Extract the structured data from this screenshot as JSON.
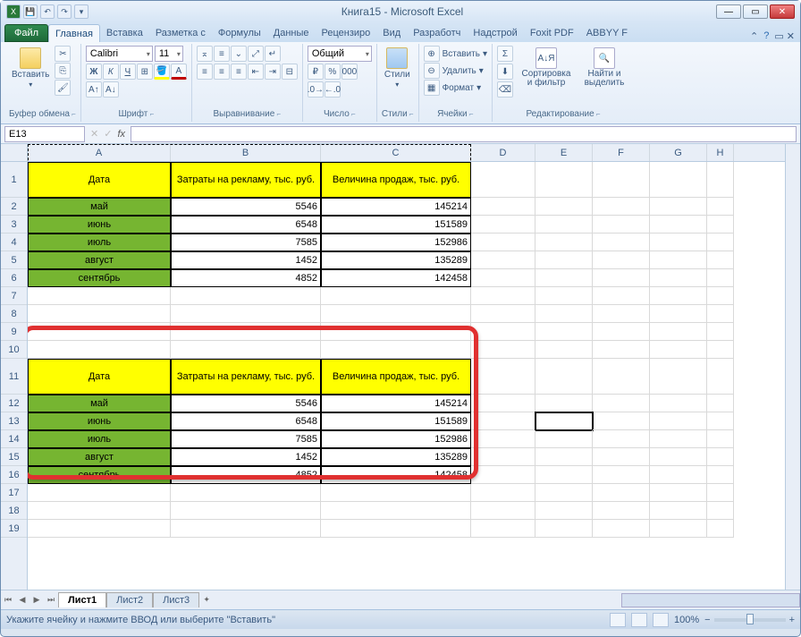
{
  "window": {
    "title": "Книга15 - Microsoft Excel"
  },
  "tabs": {
    "file": "Файл",
    "items": [
      "Главная",
      "Вставка",
      "Разметка с",
      "Формулы",
      "Данные",
      "Рецензиро",
      "Вид",
      "Разработч",
      "Надстрой",
      "Foxit PDF",
      "ABBYY F"
    ],
    "active_index": 0
  },
  "ribbon": {
    "clipboard": {
      "label": "Буфер обмена",
      "paste": "Вставить"
    },
    "font": {
      "label": "Шрифт",
      "name": "Calibri",
      "size": "11"
    },
    "align": {
      "label": "Выравнивание"
    },
    "number": {
      "label": "Число",
      "format": "Общий"
    },
    "styles": {
      "label": "Стили",
      "button": "Стили"
    },
    "cells": {
      "label": "Ячейки",
      "insert": "Вставить",
      "delete": "Удалить",
      "format": "Формат"
    },
    "editing": {
      "label": "Редактирование",
      "sort": "Сортировка и фильтр",
      "find": "Найти и выделить"
    }
  },
  "formula_bar": {
    "name_box": "E13",
    "fx": "fx",
    "value": ""
  },
  "columns": [
    {
      "letter": "A",
      "width": 160
    },
    {
      "letter": "B",
      "width": 168
    },
    {
      "letter": "C",
      "width": 168
    },
    {
      "letter": "D",
      "width": 72
    },
    {
      "letter": "E",
      "width": 64
    },
    {
      "letter": "F",
      "width": 64
    },
    {
      "letter": "G",
      "width": 64
    },
    {
      "letter": "H",
      "width": 30
    }
  ],
  "table_headers": [
    "Дата",
    "Затраты на рекламу, тыс. руб.",
    "Величина продаж, тыс. руб."
  ],
  "table_rows": [
    {
      "date": "май",
      "cost": "5546",
      "sales": "145214"
    },
    {
      "date": "июнь",
      "cost": "6548",
      "sales": "151589"
    },
    {
      "date": "июль",
      "cost": "7585",
      "sales": "152986"
    },
    {
      "date": "август",
      "cost": "1452",
      "sales": "135289"
    },
    {
      "date": "сентябрь",
      "cost": "4852",
      "sales": "142458"
    }
  ],
  "row_numbers": [
    "1",
    "2",
    "3",
    "4",
    "5",
    "6",
    "7",
    "8",
    "9",
    "10",
    "11",
    "12",
    "13",
    "14",
    "15",
    "16",
    "17",
    "18",
    "19"
  ],
  "sheets": {
    "items": [
      "Лист1",
      "Лист2",
      "Лист3"
    ],
    "active_index": 0
  },
  "status": {
    "message": "Укажите ячейку и нажмите ВВОД или выберите \"Вставить\"",
    "zoom": "100%"
  },
  "selected_cell": "E13"
}
